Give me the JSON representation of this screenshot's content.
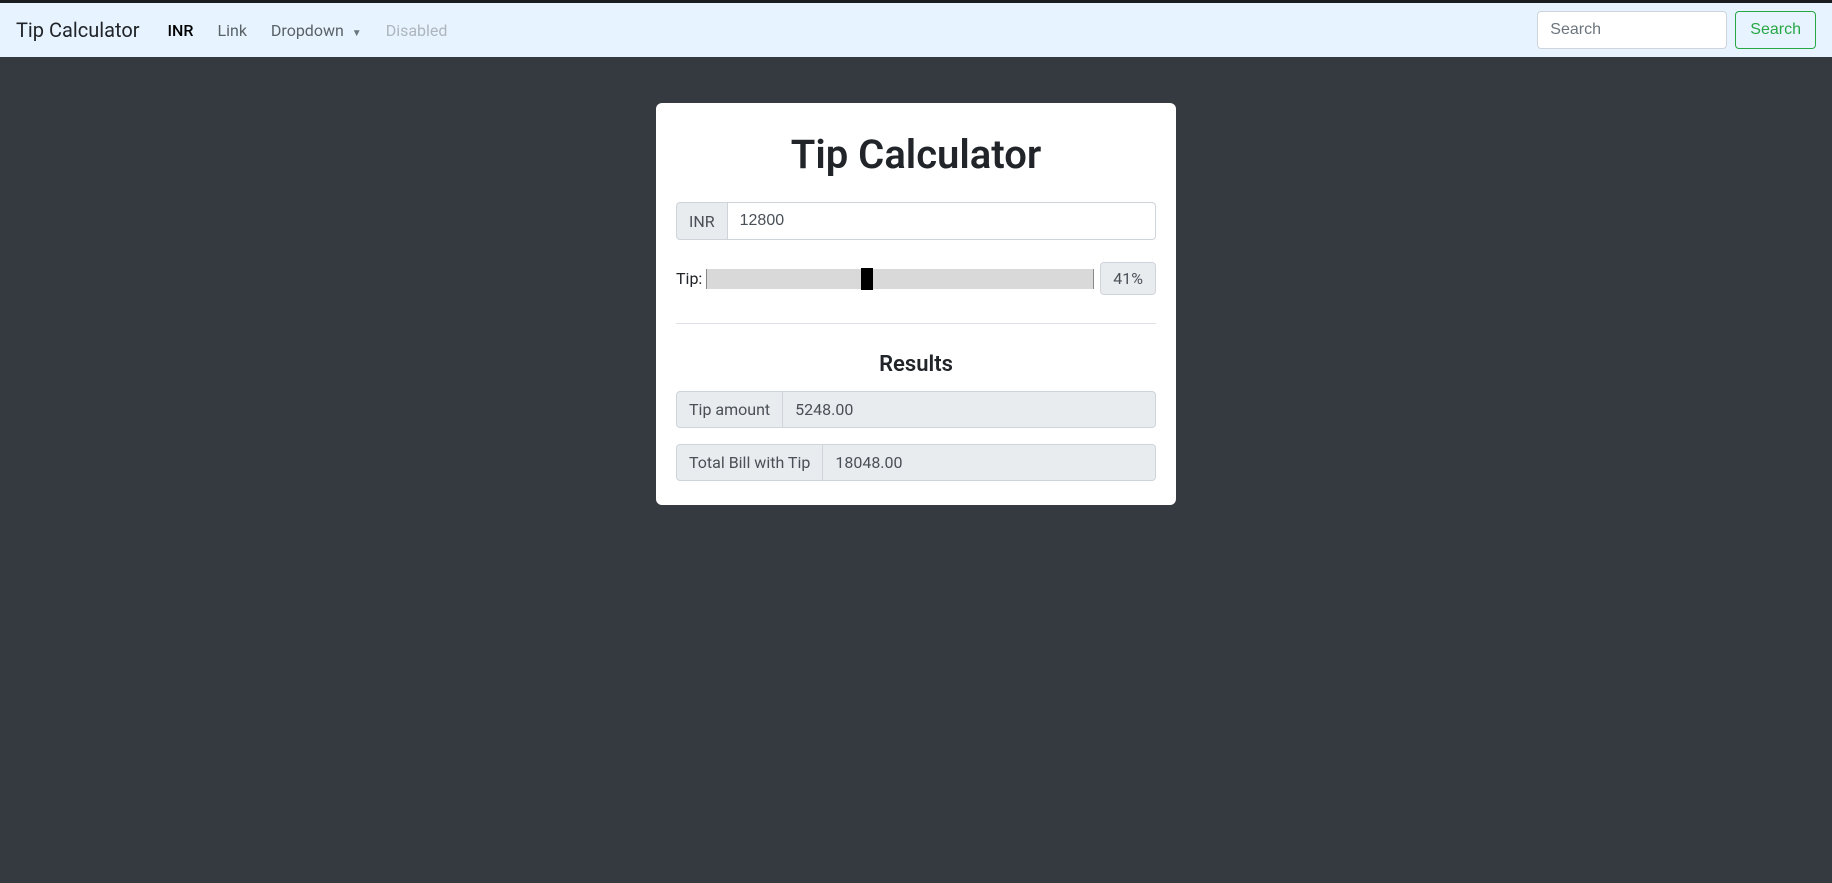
{
  "navbar": {
    "brand": "Tip Calculator",
    "links": {
      "currency": "INR",
      "link": "Link",
      "dropdown": "Dropdown",
      "disabled": "Disabled"
    },
    "search_placeholder": "Search",
    "search_button": "Search"
  },
  "card": {
    "title": "Tip Calculator",
    "currency_label": "INR",
    "amount_value": "12800",
    "tip_label": "Tip:",
    "tip_percent_display": "41%",
    "tip_value": "41",
    "tip_min": "0",
    "tip_max": "100",
    "results_heading": "Results",
    "tip_amount_label": "Tip amount",
    "tip_amount_value": "5248.00",
    "total_label": "Total Bill with Tip",
    "total_value": "18048.00"
  }
}
